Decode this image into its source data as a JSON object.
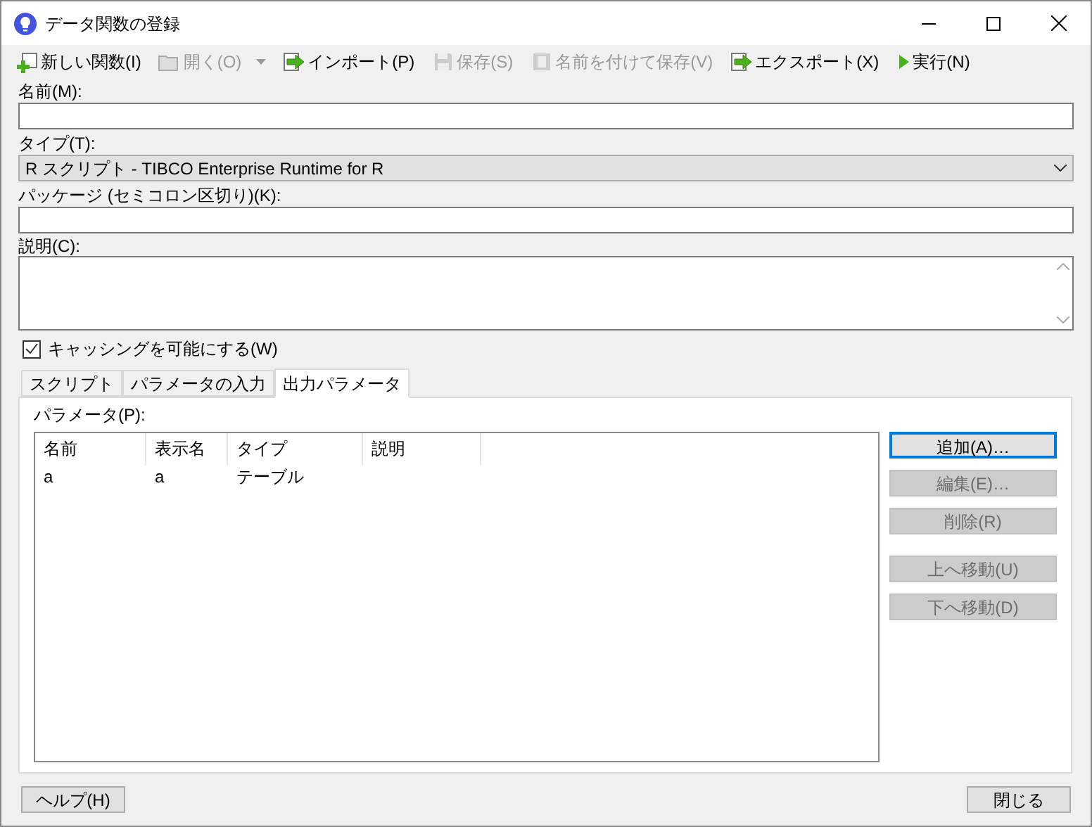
{
  "window": {
    "title": "データ関数の登録"
  },
  "toolbar": [
    {
      "label": "新しい関数(I)",
      "kind": "new",
      "disabled": false
    },
    {
      "label": "開く(O)",
      "kind": "open",
      "disabled": true,
      "dropdown": true
    },
    {
      "label": "インポート(P)",
      "kind": "import",
      "disabled": false
    },
    {
      "label": "保存(S)",
      "kind": "save",
      "disabled": true
    },
    {
      "label": "名前を付けて保存(V)",
      "kind": "saveas",
      "disabled": true
    },
    {
      "label": "エクスポート(X)",
      "kind": "export",
      "disabled": false
    },
    {
      "label": "実行(N)",
      "kind": "run",
      "disabled": false
    }
  ],
  "name_field": {
    "label": "名前(M):"
  },
  "type_field": {
    "label": "タイプ(T):",
    "value": "R スクリプト - TIBCO Enterprise Runtime for R"
  },
  "package_field": {
    "label": "パッケージ (セミコロン区切り)(K):"
  },
  "description_field": {
    "label": "説明(C):"
  },
  "caching": {
    "label": "キャッシングを可能にする(W)",
    "checked": true
  },
  "tabs": [
    {
      "label": "スクリプト",
      "selected": false
    },
    {
      "label": "パラメータの入力",
      "selected": false
    },
    {
      "label": "出力パラメータ",
      "selected": true
    }
  ],
  "parameters": {
    "label": "パラメータ(P):",
    "columns": [
      "名前",
      "表示名",
      "タイプ",
      "説明"
    ],
    "rows": [
      [
        "a",
        "a",
        "テーブル",
        ""
      ]
    ]
  },
  "side_buttons": [
    {
      "label": "追加(A)…",
      "disabled": false,
      "focused": true
    },
    {
      "label": "編集(E)…",
      "disabled": true,
      "focused": false
    },
    {
      "label": "削除(R)",
      "disabled": true,
      "focused": false
    },
    {
      "label": "上へ移動(U)",
      "disabled": true,
      "focused": false,
      "gap": true
    },
    {
      "label": "下へ移動(D)",
      "disabled": true,
      "focused": false
    }
  ],
  "footer": {
    "help": "ヘルプ(H)",
    "close": "閉じる"
  }
}
